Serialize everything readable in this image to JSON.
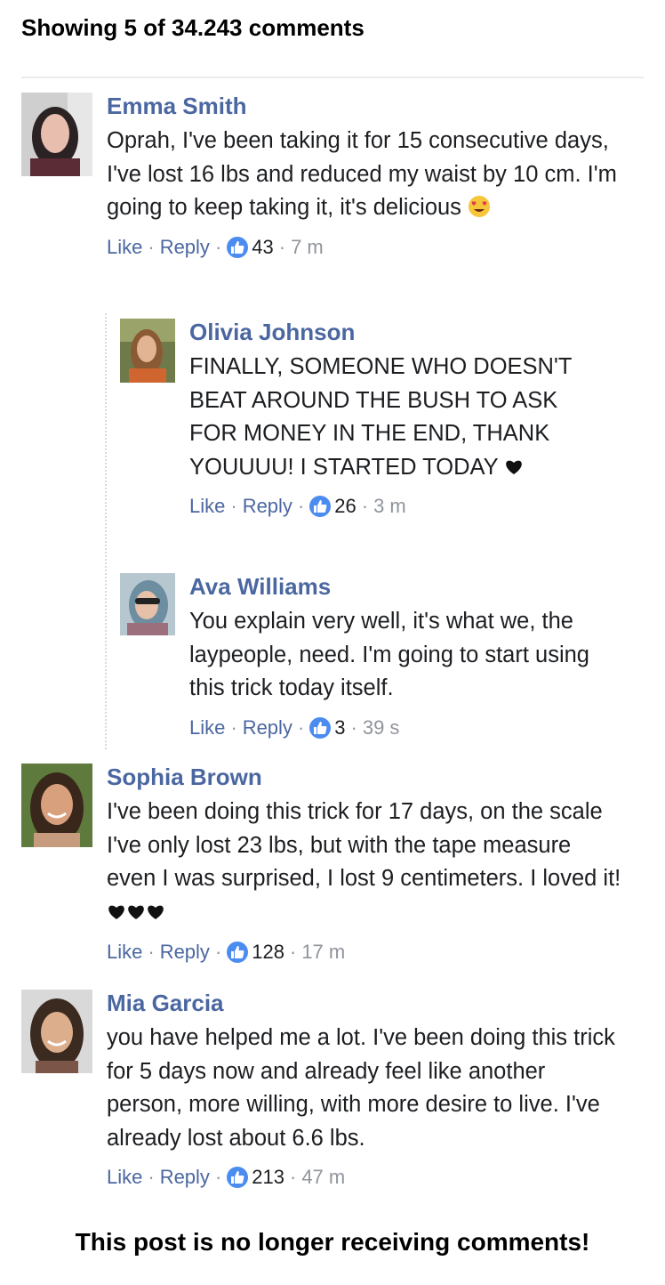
{
  "header": {
    "title": "Showing 5 of 34.243 comments"
  },
  "labels": {
    "like": "Like",
    "reply": "Reply",
    "sep": "·"
  },
  "comments": [
    {
      "name": "Emma Smith",
      "text": "Oprah, I've been taking it for 15 consecutive days, I've lost 16 lbs and reduced my waist by 10 cm. I'm going to keep taking it, it's delicious",
      "likes": "43",
      "time": "7 m"
    },
    {
      "name": "Olivia Johnson",
      "text": "FINALLY, SOMEONE WHO DOESN'T BEAT AROUND THE BUSH TO ASK FOR MONEY IN THE END, THANK YOUUUU! I STARTED TODAY",
      "likes": "26",
      "time": "3 m"
    },
    {
      "name": "Ava Williams",
      "text": "You explain very well, it's what we, the laypeople, need. I'm going to start using this trick today itself.",
      "likes": "3",
      "time": "39 s"
    },
    {
      "name": "Sophia Brown",
      "text": "I've been doing this trick for 17 days, on the scale I've only lost 23 lbs, but with the tape measure even I was surprised, I lost 9 centimeters. I loved it!",
      "likes": "128",
      "time": "17 m"
    },
    {
      "name": "Mia Garcia",
      "text": "you have helped me a lot. I've been doing this trick for 5 days now and already feel like another person, more willing, with more desire to live. I've already lost about 6.6 lbs.",
      "likes": "213",
      "time": "47 m"
    }
  ],
  "footer": {
    "text": "This post is no longer receiving comments!"
  },
  "colors": {
    "name": "#4b67a1",
    "like_badge": "#4b8cf0",
    "meta": "#90949c"
  }
}
